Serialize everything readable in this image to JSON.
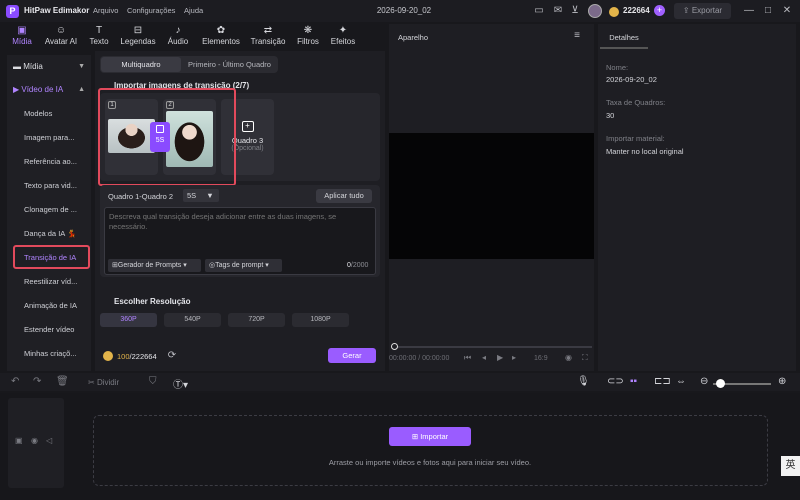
{
  "app": {
    "name": "HitPaw Edimakor",
    "menu": [
      "Arquivo",
      "Configurações",
      "Ajuda"
    ],
    "document_title": "2026-09-20_02",
    "credits": "222664",
    "export_label": "Exportar",
    "accent_color": "#9a5cff"
  },
  "tabs": [
    {
      "label": "Mídia",
      "icon": "media-icon"
    },
    {
      "label": "Avatar AI",
      "icon": "avatar-icon"
    },
    {
      "label": "Texto",
      "icon": "text-icon"
    },
    {
      "label": "Legendas",
      "icon": "subtitles-icon"
    },
    {
      "label": "Áudio",
      "icon": "audio-icon"
    },
    {
      "label": "Elementos",
      "icon": "elements-icon"
    },
    {
      "label": "Transição",
      "icon": "transition-icon"
    },
    {
      "label": "Filtros",
      "icon": "filters-icon"
    },
    {
      "label": "Efeitos",
      "icon": "effects-icon"
    }
  ],
  "sidebar": {
    "media_label": "Mídia",
    "ai_video_label": "Vídeo de IA",
    "items": [
      "Modelos",
      "Imagem para...",
      "Referência ao...",
      "Texto para vid...",
      "Clonagem de ...",
      "Dança da IA 💃",
      "Transição de IA",
      "Reestilizar víd...",
      "Animação de IA",
      "Estender vídeo",
      "Minhas criaçõ..."
    ],
    "active_item": "Transição de IA"
  },
  "transition": {
    "segment": [
      "Multiquadro",
      "Primeiro - Último Quadro"
    ],
    "import_title": "Importar imagens de transição (2/7)",
    "frame1_num": "1",
    "frame2_num": "2",
    "chip_duration": "5S",
    "frame3_label": "Quadro 3",
    "frame3_optional": "(Opcional)",
    "pair_label": "Quadro 1-Quadro 2",
    "pair_duration": "5S",
    "apply_all": "Aplicar tudo",
    "prompt_placeholder": "Descreva qual transição deseja adicionar entre as duas imagens, se necessário.",
    "prompt_generator": "Gerador de Prompts",
    "prompt_tags": "Tags de prompt",
    "char_count": "0",
    "char_max": "/2000",
    "resolution_title": "Escolher Resolução",
    "resolutions": [
      "360P",
      "540P",
      "720P",
      "1080P"
    ],
    "selected_resolution": "360P",
    "cost_used": "100",
    "cost_total": "/222664",
    "generate_label": "Gerar"
  },
  "preview": {
    "title": "Aparelho",
    "timecode": "00:00:00 / 00:00:00",
    "ratio": "16:9"
  },
  "details": {
    "tab": "Detalhes",
    "name_label": "Nome:",
    "name_value": "2026-09-20_02",
    "fps_label": "Taxa de Quadros:",
    "fps_value": "30",
    "import_label": "Importar material:",
    "import_value": "Manter no local original"
  },
  "timeline": {
    "split_label": "Dividir",
    "import_button": "Importar",
    "drop_hint": "Arraste ou importe vídeos e fotos aqui para iniciar seu vídeo."
  }
}
